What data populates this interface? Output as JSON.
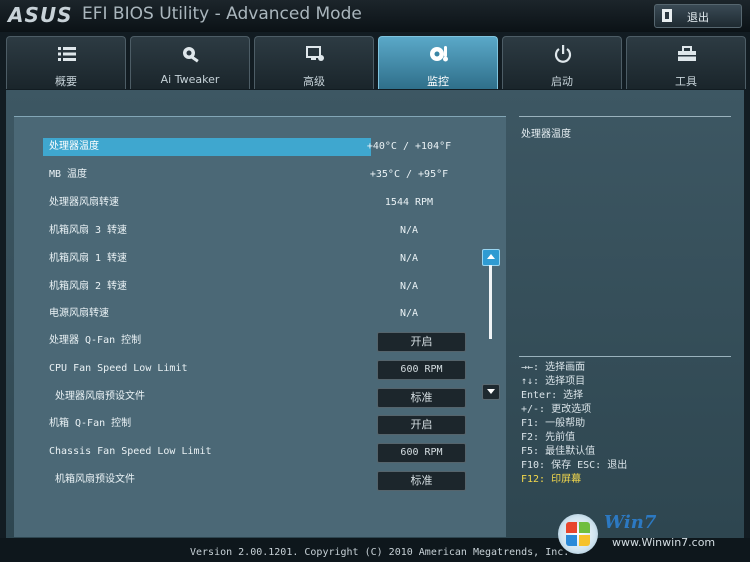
{
  "window": {
    "brand": "ASUS",
    "title": "EFI BIOS Utility - Advanced Mode",
    "exit_label": "退出"
  },
  "tabs": [
    {
      "label": "概要",
      "icon": "list-icon"
    },
    {
      "label": "Ai Tweaker",
      "icon": "ai-tweaker-icon"
    },
    {
      "label": "高级",
      "icon": "advanced-icon"
    },
    {
      "label": "监控",
      "icon": "monitor-icon",
      "active": true
    },
    {
      "label": "启动",
      "icon": "power-icon"
    },
    {
      "label": "工具",
      "icon": "tool-icon"
    }
  ],
  "rows": [
    {
      "label": "处理器温度",
      "value": "+40°C / +104°F"
    },
    {
      "label": "MB 温度",
      "value": "+35°C / +95°F"
    },
    {
      "label": "处理器风扇转速",
      "value": "1544 RPM"
    },
    {
      "label": "机箱风扇 3 转速",
      "value": "N/A"
    },
    {
      "label": "机箱风扇 1 转速",
      "value": "N/A"
    },
    {
      "label": "机箱风扇 2 转速",
      "value": "N/A"
    },
    {
      "label": "电源风扇转速",
      "value": "N/A"
    },
    {
      "label": "处理器 Q-Fan 控制",
      "button": "开启"
    },
    {
      "label": "CPU Fan Speed Low Limit",
      "button": "600 RPM"
    },
    {
      "label": "处理器风扇预设文件",
      "button": "标准"
    },
    {
      "label": "机箱 Q-Fan 控制",
      "button": "开启"
    },
    {
      "label": "Chassis Fan Speed Low Limit",
      "button": "600 RPM"
    },
    {
      "label": "机箱风扇预设文件",
      "button": "标准"
    }
  ],
  "help": {
    "title": "处理器温度",
    "keys": [
      "→←: 选择画面",
      "↑↓: 选择项目",
      "Enter: 选择",
      "+/-: 更改选项",
      "F1: 一般帮助",
      "F2: 先前值",
      "F5: 最佳默认值",
      "F10: 保存  ESC: 退出",
      "F12: 印屏幕"
    ]
  },
  "footer": {
    "copyright": "Version 2.00.1201. Copyright (C) 2010 American Megatrends, Inc.",
    "watermark_brand": "Win7",
    "watermark_url": "www.Winwin7.com"
  },
  "colors": {
    "highlight": "#3fa7cf",
    "active_tab": "#4a9bbd",
    "panel": "#4b6876",
    "hotkey_highlight": "#f3d84c"
  }
}
